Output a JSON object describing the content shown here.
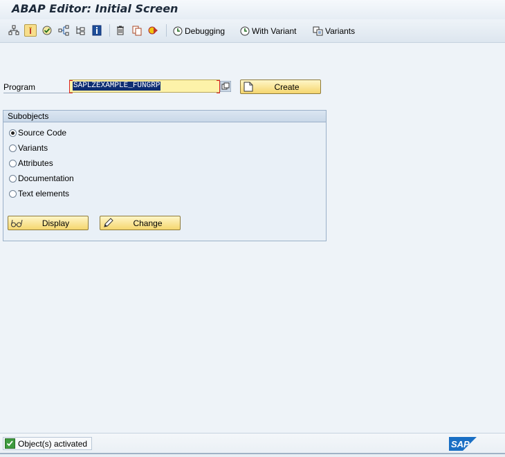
{
  "window": {
    "title": "ABAP Editor: Initial Screen"
  },
  "toolbar": {
    "icons": [
      "hierarchy-icon",
      "other-object-icon",
      "check-icon",
      "where-used-icon",
      "tree-icon",
      "info-icon",
      "delete-icon",
      "copy-icon",
      "activate-icon"
    ],
    "debugging_label": "Debugging",
    "with_variant_label": "With Variant",
    "variants_label": "Variants"
  },
  "program": {
    "label": "Program",
    "value": "SAPLZEXAMPLE_FUNGRP",
    "create_label": "Create"
  },
  "subobjects": {
    "title": "Subobjects",
    "options": [
      {
        "label": "Source Code",
        "selected": true
      },
      {
        "label": "Variants",
        "selected": false
      },
      {
        "label": "Attributes",
        "selected": false
      },
      {
        "label": "Documentation",
        "selected": false
      },
      {
        "label": "Text elements",
        "selected": false
      }
    ],
    "display_label": "Display",
    "change_label": "Change"
  },
  "status": {
    "message": "Object(s) activated",
    "logo_text": "SAP"
  },
  "colors": {
    "button_gold": "#f5d66e",
    "input_yellow": "#fdf2a9",
    "selected_blue": "#0d2d72",
    "status_green": "#3f9b3f",
    "sap_blue": "#1a6fc4"
  }
}
